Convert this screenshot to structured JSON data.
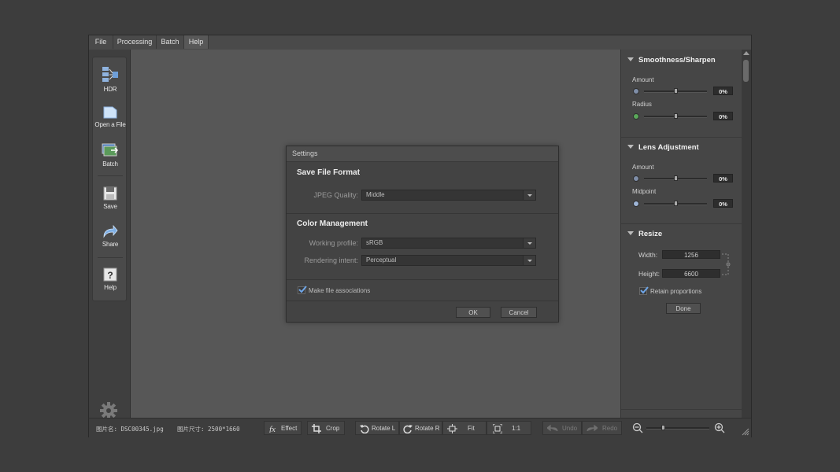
{
  "menu": [
    "File",
    "Processing",
    "Batch",
    "Help"
  ],
  "tools": [
    {
      "label": "HDR",
      "icon": "hdr-icon"
    },
    {
      "label": "Open a File",
      "icon": "open-file-icon"
    },
    {
      "label": "Batch",
      "icon": "batch-icon"
    },
    {
      "label": "Save",
      "icon": "save-icon"
    },
    {
      "label": "Share",
      "icon": "share-icon"
    },
    {
      "label": "Help",
      "icon": "help-icon"
    }
  ],
  "settings_icon": "gear-icon",
  "dialog": {
    "title": "Settings",
    "save_format": {
      "heading": "Save File Format",
      "jpeg_quality_label": "JPEG Quality:",
      "jpeg_quality_value": "Middle"
    },
    "color_management": {
      "heading": "Color Management",
      "working_profile_label": "Working profile:",
      "working_profile_value": "sRGB",
      "rendering_intent_label": "Rendering intent:",
      "rendering_intent_value": "Perceptual"
    },
    "file_assoc_label": "Make file associations",
    "file_assoc_checked": true,
    "ok_label": "OK",
    "cancel_label": "Cancel"
  },
  "panel": {
    "smoothness": {
      "heading": "Smoothness/Sharpen",
      "amount_label": "Amount",
      "amount_value": "0%",
      "radius_label": "Radius",
      "radius_value": "0%"
    },
    "lens": {
      "heading": "Lens Adjustment",
      "amount_label": "Amount",
      "amount_value": "0%",
      "midpoint_label": "Midpoint",
      "midpoint_value": "0%"
    },
    "resize": {
      "heading": "Resize",
      "width_label": "Width:",
      "width_value": "1256",
      "height_label": "Height:",
      "height_value": "6600",
      "retain_label": "Retain proportions",
      "retain_checked": true,
      "done_label": "Done"
    }
  },
  "status": {
    "file_name": "图片名: DSC00345.jpg",
    "file_size": "图片尺寸: 2500*1660"
  },
  "toolbar": {
    "effect": "Effect",
    "crop": "Crop",
    "rotate_l": "Rotate L",
    "rotate_r": "Rotate R",
    "fit": "Fit",
    "one_to_one": "1:1",
    "undo": "Undo",
    "redo": "Redo"
  }
}
